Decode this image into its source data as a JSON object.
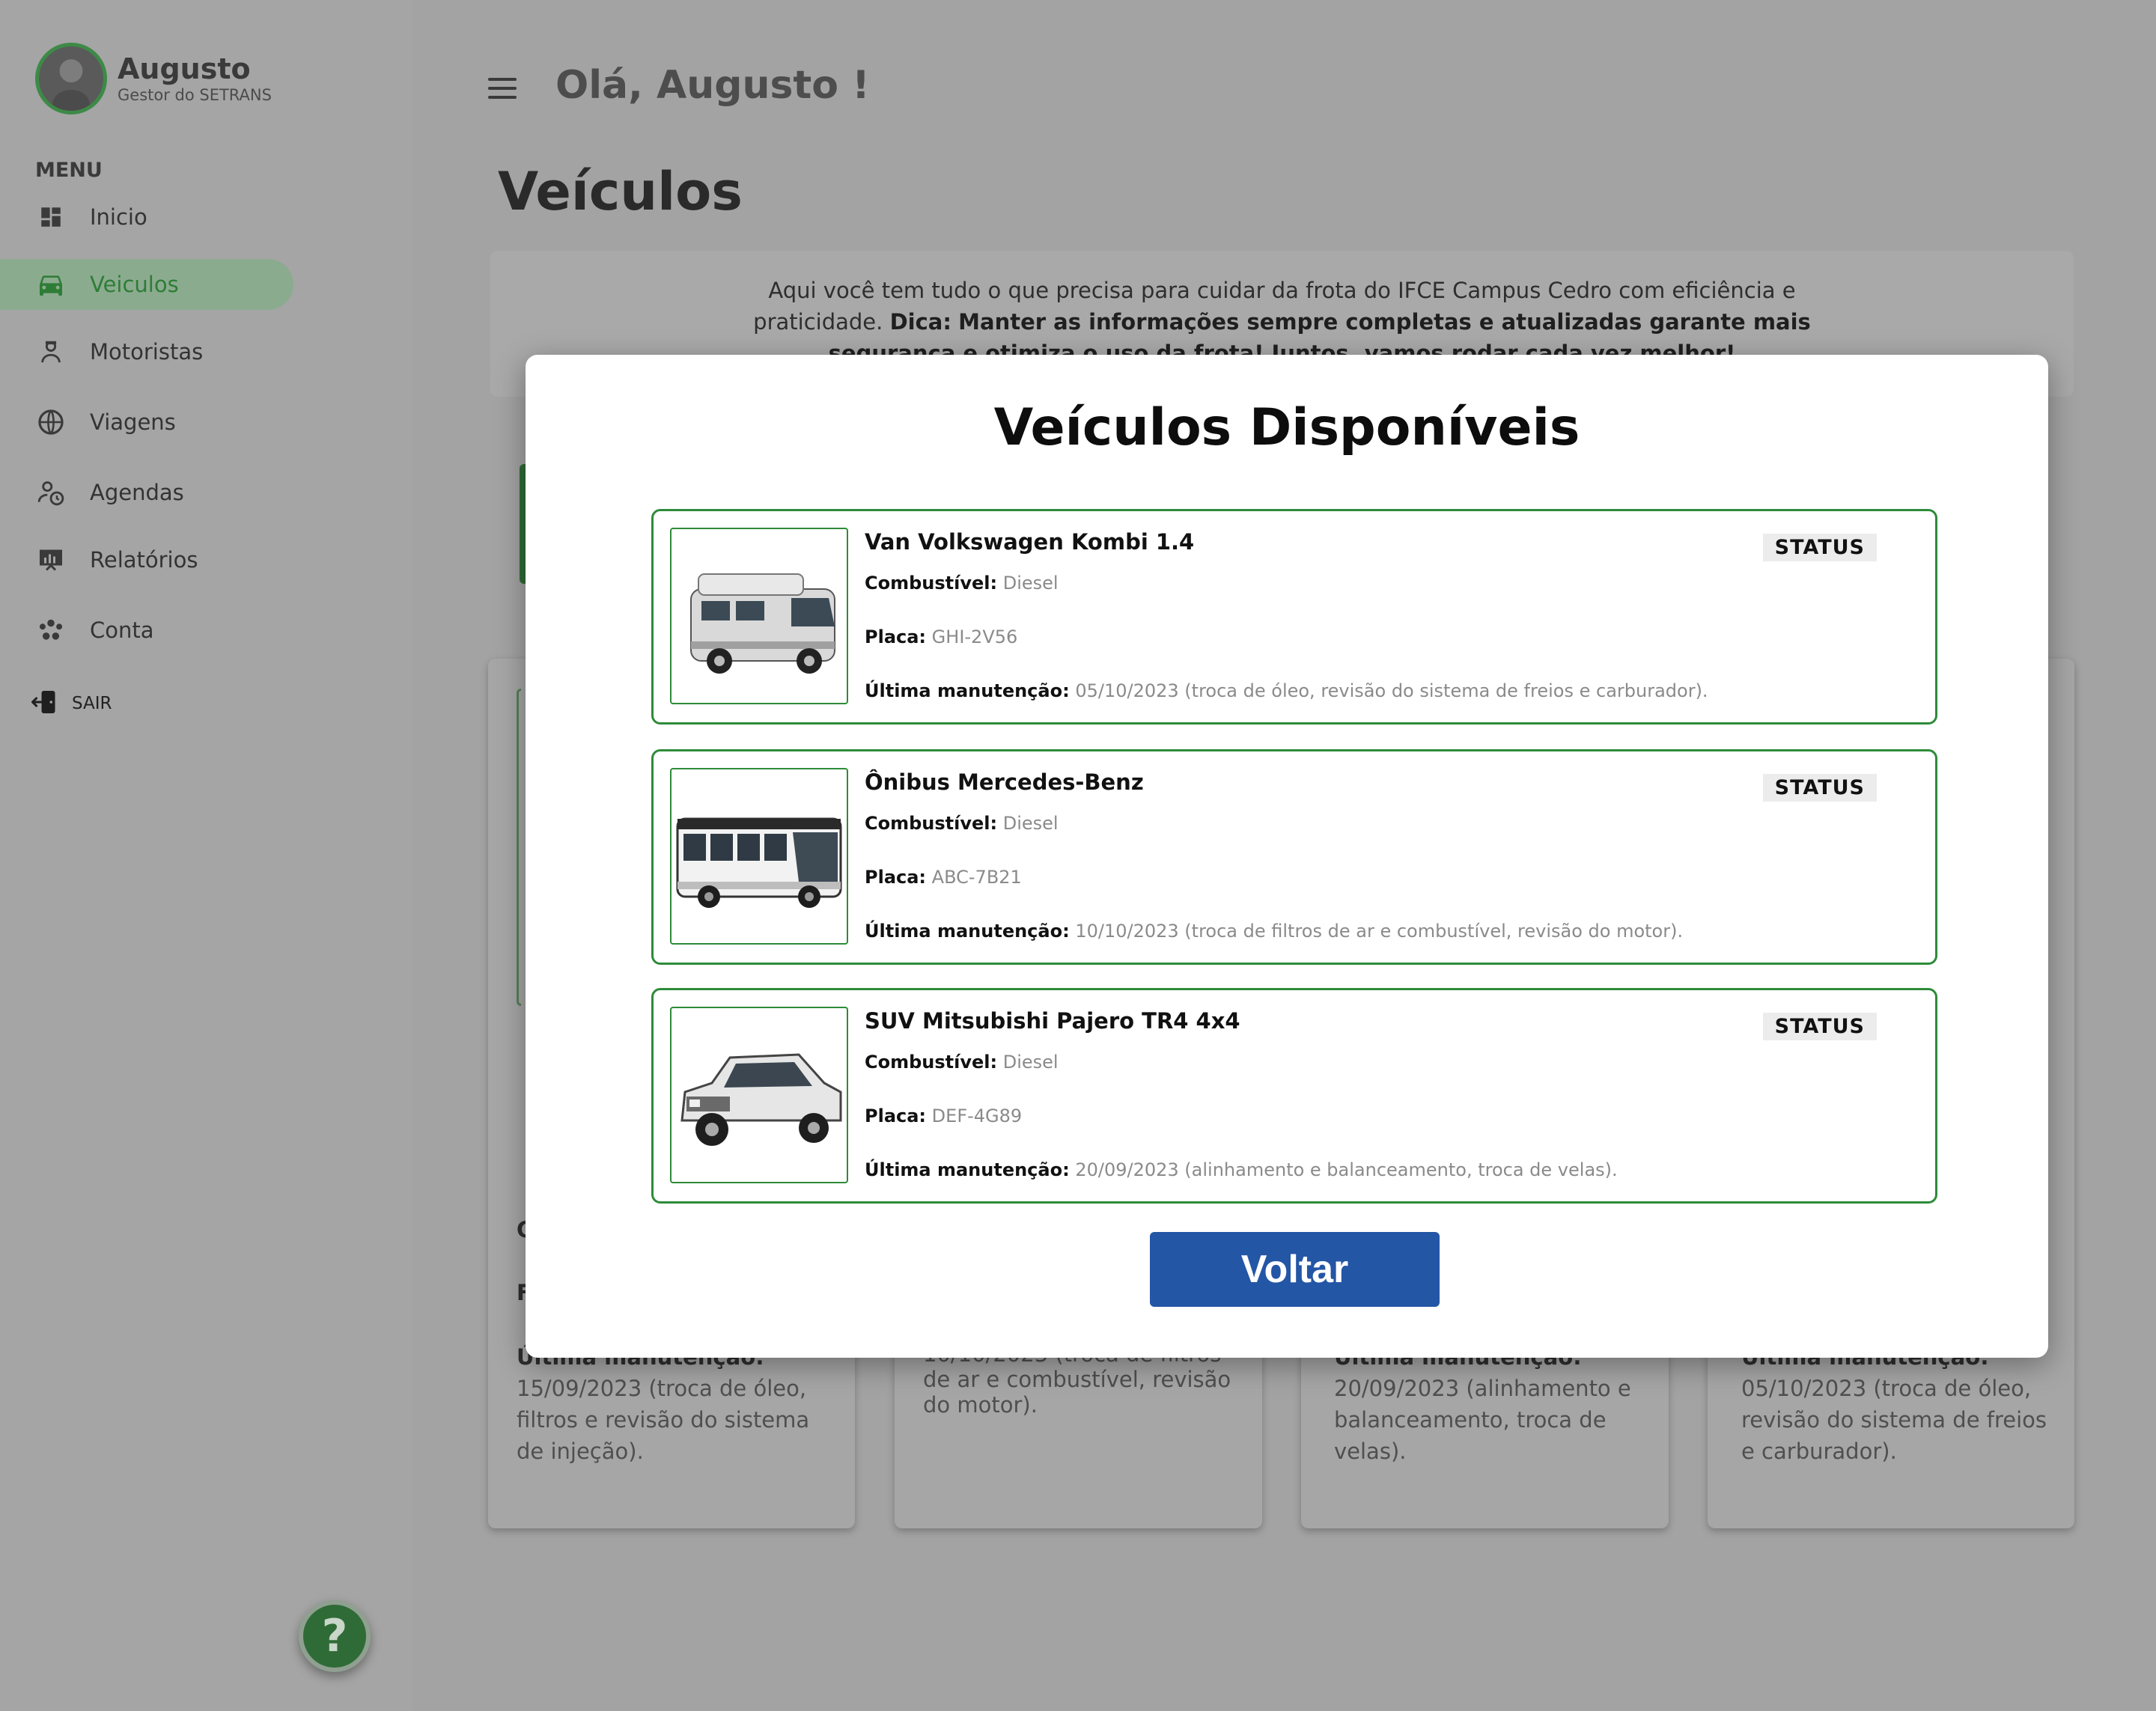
{
  "profile": {
    "name": "Augusto",
    "role": "Gestor do SETRANS"
  },
  "menu": {
    "title": "MENU",
    "items": [
      {
        "label": "Inicio",
        "icon": "dashboard-icon"
      },
      {
        "label": "Veiculos",
        "icon": "car-icon",
        "active": true
      },
      {
        "label": "Motoristas",
        "icon": "driver-icon"
      },
      {
        "label": "Viagens",
        "icon": "globe-icon"
      },
      {
        "label": "Agendas",
        "icon": "schedule-icon"
      },
      {
        "label": "Relatórios",
        "icon": "report-icon"
      },
      {
        "label": "Conta",
        "icon": "account-icon"
      }
    ],
    "logout": "SAIR"
  },
  "help": {
    "label": "?"
  },
  "header": {
    "greeting": "Olá, Augusto !",
    "page_title": "Veículos"
  },
  "intro": {
    "text": "Aqui você tem tudo o que precisa para cuidar da frota do IFCE Campus Cedro com eficiência e praticidade.",
    "tip_label": "Dica:",
    "tip_text": "Manter as informações sempre completas e atualizadas garante mais segurança e otimiza o uso da frota! Juntos, vamos rodar cada vez melhor!"
  },
  "background_cards": {
    "card1": {
      "partial_1": "C",
      "partial_2": "F",
      "maint_label": "Última manutenção:",
      "maint_text": "15/09/2023 (troca de óleo, filtros e revisão do sistema de injeção)."
    },
    "card2": {
      "maint_text": "10/10/2023 (troca de filtros de ar e combustível, revisão do motor)."
    },
    "card3": {
      "maint_label": "Última manutenção:",
      "maint_text": "20/09/2023 (alinhamento e balanceamento, troca de velas)."
    },
    "card4": {
      "maint_label": "Última manutenção:",
      "maint_text": "05/10/2023 (troca de óleo, revisão do sistema de freios e carburador)."
    }
  },
  "modal": {
    "title": "Veículos Disponíveis",
    "labels": {
      "fuel": "Combustível:",
      "plate": "Placa:",
      "maintenance": "Última manutenção:",
      "status": "STATUS"
    },
    "vehicles": [
      {
        "name": "Van Volkswagen Kombi 1.4",
        "fuel": "Diesel",
        "plate": "GHI-2V56",
        "maintenance": "05/10/2023 (troca de óleo, revisão do sistema de freios e carburador).",
        "image": "van-image"
      },
      {
        "name": "Ônibus Mercedes-Benz",
        "fuel": "Diesel",
        "plate": "ABC-7B21",
        "maintenance": "10/10/2023 (troca de filtros de ar e combustível, revisão do motor).",
        "image": "bus-image"
      },
      {
        "name": "SUV Mitsubishi Pajero TR4 4x4",
        "fuel": "Diesel",
        "plate": "DEF-4G89",
        "maintenance": "20/09/2023 (alinhamento e balanceamento, troca de velas).",
        "image": "suv-image"
      }
    ],
    "back_button": "Voltar"
  },
  "colors": {
    "accent_green": "#2e8b3a",
    "button_blue": "#2456a6",
    "overlay_gray": "#a3a3a3"
  }
}
